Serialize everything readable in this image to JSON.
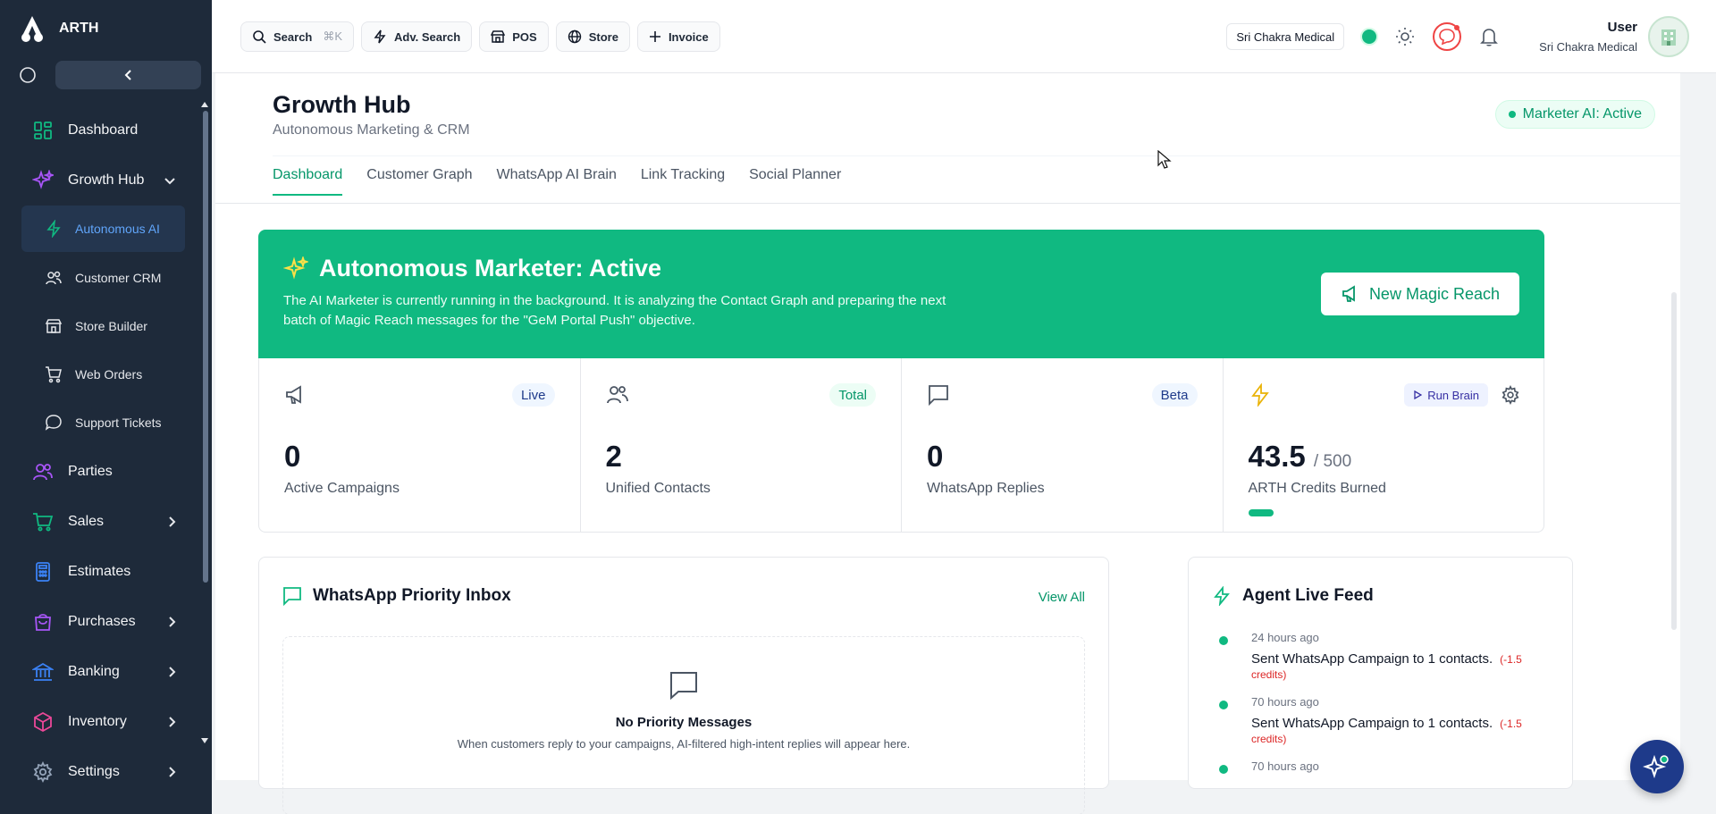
{
  "brand": {
    "name": "ARTH"
  },
  "sidebar": {
    "items": [
      {
        "label": "Dashboard",
        "icon": "grid-icon"
      },
      {
        "label": "Growth Hub",
        "icon": "sparkles-icon"
      },
      {
        "label": "Parties",
        "icon": "users-icon"
      },
      {
        "label": "Sales",
        "icon": "cart-icon"
      },
      {
        "label": "Estimates",
        "icon": "calculator-icon"
      },
      {
        "label": "Purchases",
        "icon": "bag-icon"
      },
      {
        "label": "Banking",
        "icon": "bank-icon"
      },
      {
        "label": "Inventory",
        "icon": "box-icon"
      },
      {
        "label": "Settings",
        "icon": "gear-icon"
      }
    ],
    "sub_items": [
      {
        "label": "Autonomous AI",
        "icon": "bolt-icon"
      },
      {
        "label": "Customer CRM",
        "icon": "users-icon"
      },
      {
        "label": "Store Builder",
        "icon": "store-icon"
      },
      {
        "label": "Web Orders",
        "icon": "cart-icon"
      },
      {
        "label": "Support Tickets",
        "icon": "chat-icon"
      }
    ]
  },
  "topbar": {
    "search": "Search",
    "search_kbd": "⌘K",
    "adv_search": "Adv. Search",
    "pos": "POS",
    "store": "Store",
    "invoice": "Invoice",
    "store_pill": "Sri Chakra Medical",
    "user_name": "User",
    "user_store": "Sri Chakra Medical"
  },
  "page": {
    "title": "Growth Hub",
    "subtitle": "Autonomous Marketing & CRM",
    "ai_status": "Marketer AI: Active",
    "tabs": [
      "Dashboard",
      "Customer Graph",
      "WhatsApp AI Brain",
      "Link Tracking",
      "Social Planner"
    ]
  },
  "hero": {
    "title": "Autonomous Marketer: Active",
    "desc": "The AI Marketer is currently running in the background. It is analyzing the Contact Graph and preparing the next batch of Magic Reach messages for the \"GeM Portal Push\" objective.",
    "button": "New Magic Reach"
  },
  "stats": [
    {
      "badge": "Live",
      "value": "0",
      "label": "Active Campaigns"
    },
    {
      "badge": "Total",
      "value": "2",
      "label": "Unified Contacts"
    },
    {
      "badge": "Beta",
      "value": "0",
      "label": "WhatsApp Replies"
    },
    {
      "run_brain": "Run Brain",
      "value": "43.5",
      "of": "/ 500",
      "label": "ARTH Credits Burned",
      "progress": 0.087
    }
  ],
  "inbox": {
    "title": "WhatsApp Priority Inbox",
    "view_all": "View All",
    "empty_title": "No Priority Messages",
    "empty_desc": "When customers reply to your campaigns, AI-filtered high-intent replies will appear here."
  },
  "feed": {
    "title": "Agent Live Feed",
    "items": [
      {
        "time": "24 hours ago",
        "text": "Sent WhatsApp Campaign to 1 contacts.",
        "cost": "(-1.5 credits)"
      },
      {
        "time": "70 hours ago",
        "text": "Sent WhatsApp Campaign to 1 contacts.",
        "cost": "(-1.5 credits)"
      },
      {
        "time": "70 hours ago",
        "text": "",
        "cost": ""
      }
    ]
  },
  "colors": {
    "accent": "#10b981",
    "sidebar": "#1e2a3a",
    "active_link": "#60a5fa"
  }
}
